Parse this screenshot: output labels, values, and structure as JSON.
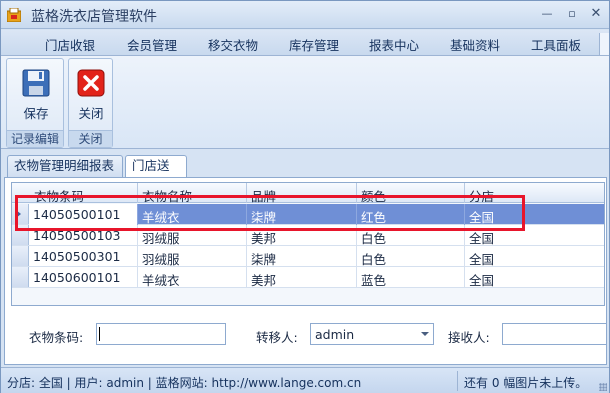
{
  "window": {
    "title": "蓝格洗衣店管理软件"
  },
  "menu": [
    "门店收银",
    "会员管理",
    "移交衣物",
    "库存管理",
    "报表中心",
    "基础资料",
    "工具面板"
  ],
  "ribbon": {
    "groups": [
      {
        "caption": "记录编辑",
        "buttons": [
          {
            "label": "保存",
            "icon": "floppy-disk-icon"
          }
        ]
      },
      {
        "caption": "关闭",
        "buttons": [
          {
            "label": "关闭",
            "icon": "close-red-x-icon"
          }
        ]
      }
    ]
  },
  "doc_tabs": [
    {
      "label": "衣物管理明细报表",
      "active": false
    },
    {
      "label": "门店送洗",
      "active": true
    }
  ],
  "table": {
    "columns": [
      "衣物条码",
      "衣物名称",
      "品牌",
      "颜色",
      "分店"
    ],
    "rows": [
      {
        "code": "14050500101",
        "name": "羊绒衣",
        "brand": "柒牌",
        "color": "红色",
        "branch": "全国"
      },
      {
        "code": "14050500103",
        "name": "羽绒服",
        "brand": "美邦",
        "color": "白色",
        "branch": "全国"
      },
      {
        "code": "14050500301",
        "name": "羽绒服",
        "brand": "柒牌",
        "color": "白色",
        "branch": "全国"
      },
      {
        "code": "14050600101",
        "name": "羊绒衣",
        "brand": "美邦",
        "color": "蓝色",
        "branch": "全国"
      }
    ],
    "selected_row": 0
  },
  "form": {
    "barcode_label": "衣物条码:",
    "barcode_value": "",
    "transfer_label": "转移人:",
    "transfer_value": "admin",
    "receiver_label": "接收人:",
    "receiver_value": ""
  },
  "status": {
    "left": "分店: 全国  | 用户: admin  |  蓝格网站: http://www.lange.com.cn",
    "right": "还有 0 幅图片未上传。"
  },
  "colors": {
    "selection": "#6f8fd6",
    "highlight_box": "#e8152b",
    "accent": "#15315d"
  }
}
